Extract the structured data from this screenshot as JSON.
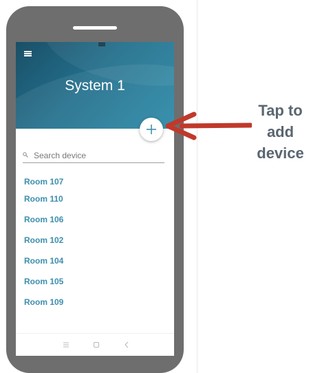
{
  "app": {
    "title": "System 1",
    "menu_icon": "hamburger-menu-icon",
    "add_button_icon": "plus-icon"
  },
  "search": {
    "placeholder": "Search device",
    "value": "",
    "icon": "search-icon"
  },
  "rooms": [
    {
      "label": "Room 107"
    },
    {
      "label": "Room 110"
    },
    {
      "label": "Room 106"
    },
    {
      "label": "Room 102"
    },
    {
      "label": "Room 104"
    },
    {
      "label": "Room 105"
    },
    {
      "label": "Room 109"
    }
  ],
  "navbar": {
    "menu_icon": "menu-icon",
    "home_icon": "square-home-icon",
    "back_icon": "back-chevron-icon"
  },
  "annotation": {
    "lines": [
      "Tap to",
      "add",
      "device"
    ],
    "arrow_icon": "arrow-left-icon"
  },
  "colors": {
    "header_start": "#1a4f66",
    "header_end": "#2a8aa8",
    "accent": "#3d8fae",
    "arrow": "#c0392b",
    "annotation_text": "#5a6670",
    "phone_frame": "#6e6e6e"
  }
}
